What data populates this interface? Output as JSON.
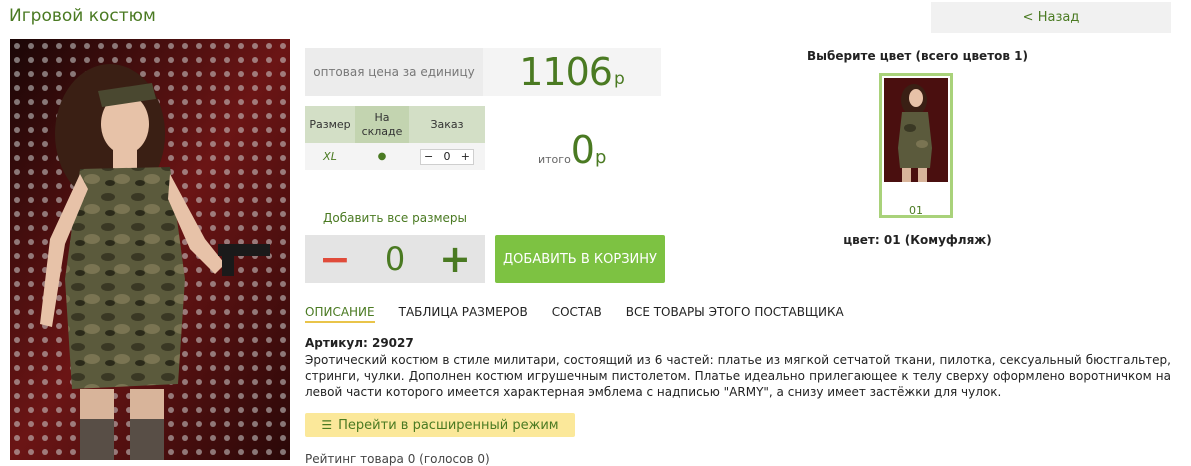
{
  "page": {
    "title": "Игровой костюм",
    "back_label": "< Назад"
  },
  "price": {
    "label": "оптовая цена за единицу",
    "value": "1106",
    "currency": "р"
  },
  "size_table": {
    "headers": {
      "size": "Размер",
      "stock": "На складе",
      "order": "Заказ"
    },
    "rows": [
      {
        "size": "XL",
        "stock": "●",
        "minus": "−",
        "qty": "0",
        "plus": "+"
      }
    ]
  },
  "total": {
    "label": "итого",
    "value": "0",
    "currency": "р"
  },
  "add_all": {
    "label": "Добавить все размеры",
    "minus": "−",
    "qty": "0",
    "plus": "+"
  },
  "cart_button": "ДОБАВИТЬ В КОРЗИНУ",
  "colors": {
    "title": "Выберите цвет (всего цветов 1)",
    "items": [
      {
        "number": "01"
      }
    ],
    "selected_label": "цвет: 01 (Комуфляж)"
  },
  "tabs": [
    {
      "label": "ОПИСАНИЕ",
      "active": true
    },
    {
      "label": "ТАБЛИЦА РАЗМЕРОВ",
      "active": false
    },
    {
      "label": "СОСТАВ",
      "active": false
    },
    {
      "label": "ВСЕ ТОВАРЫ ЭТОГО ПОСТАВЩИКА",
      "active": false
    }
  ],
  "description": {
    "article": "Артикул: 29027",
    "text": "Эротический костюм в стиле милитари, состоящий из 6 частей: платье из мягкой сетчатой ткани, пилотка, сексуальный бюстгальтер, стринги, чулки. Дополнен костюм игрушечным пистолетом. Платье идеально прилегающее к телу сверху оформлено воротничком на левой части которого имеется характерная эмблема с надписью \"ARMY\", а снизу имеет застёжки для чулок."
  },
  "advanced_button": "Перейти в расширенный режим",
  "rating_text": "Рейтинг товара 0 (голосов 0)",
  "colors_accent": {
    "green": "#4a7a22",
    "button_green": "#7dc242",
    "minus_red": "#e04b3a",
    "yellow": "#fbe89a"
  }
}
